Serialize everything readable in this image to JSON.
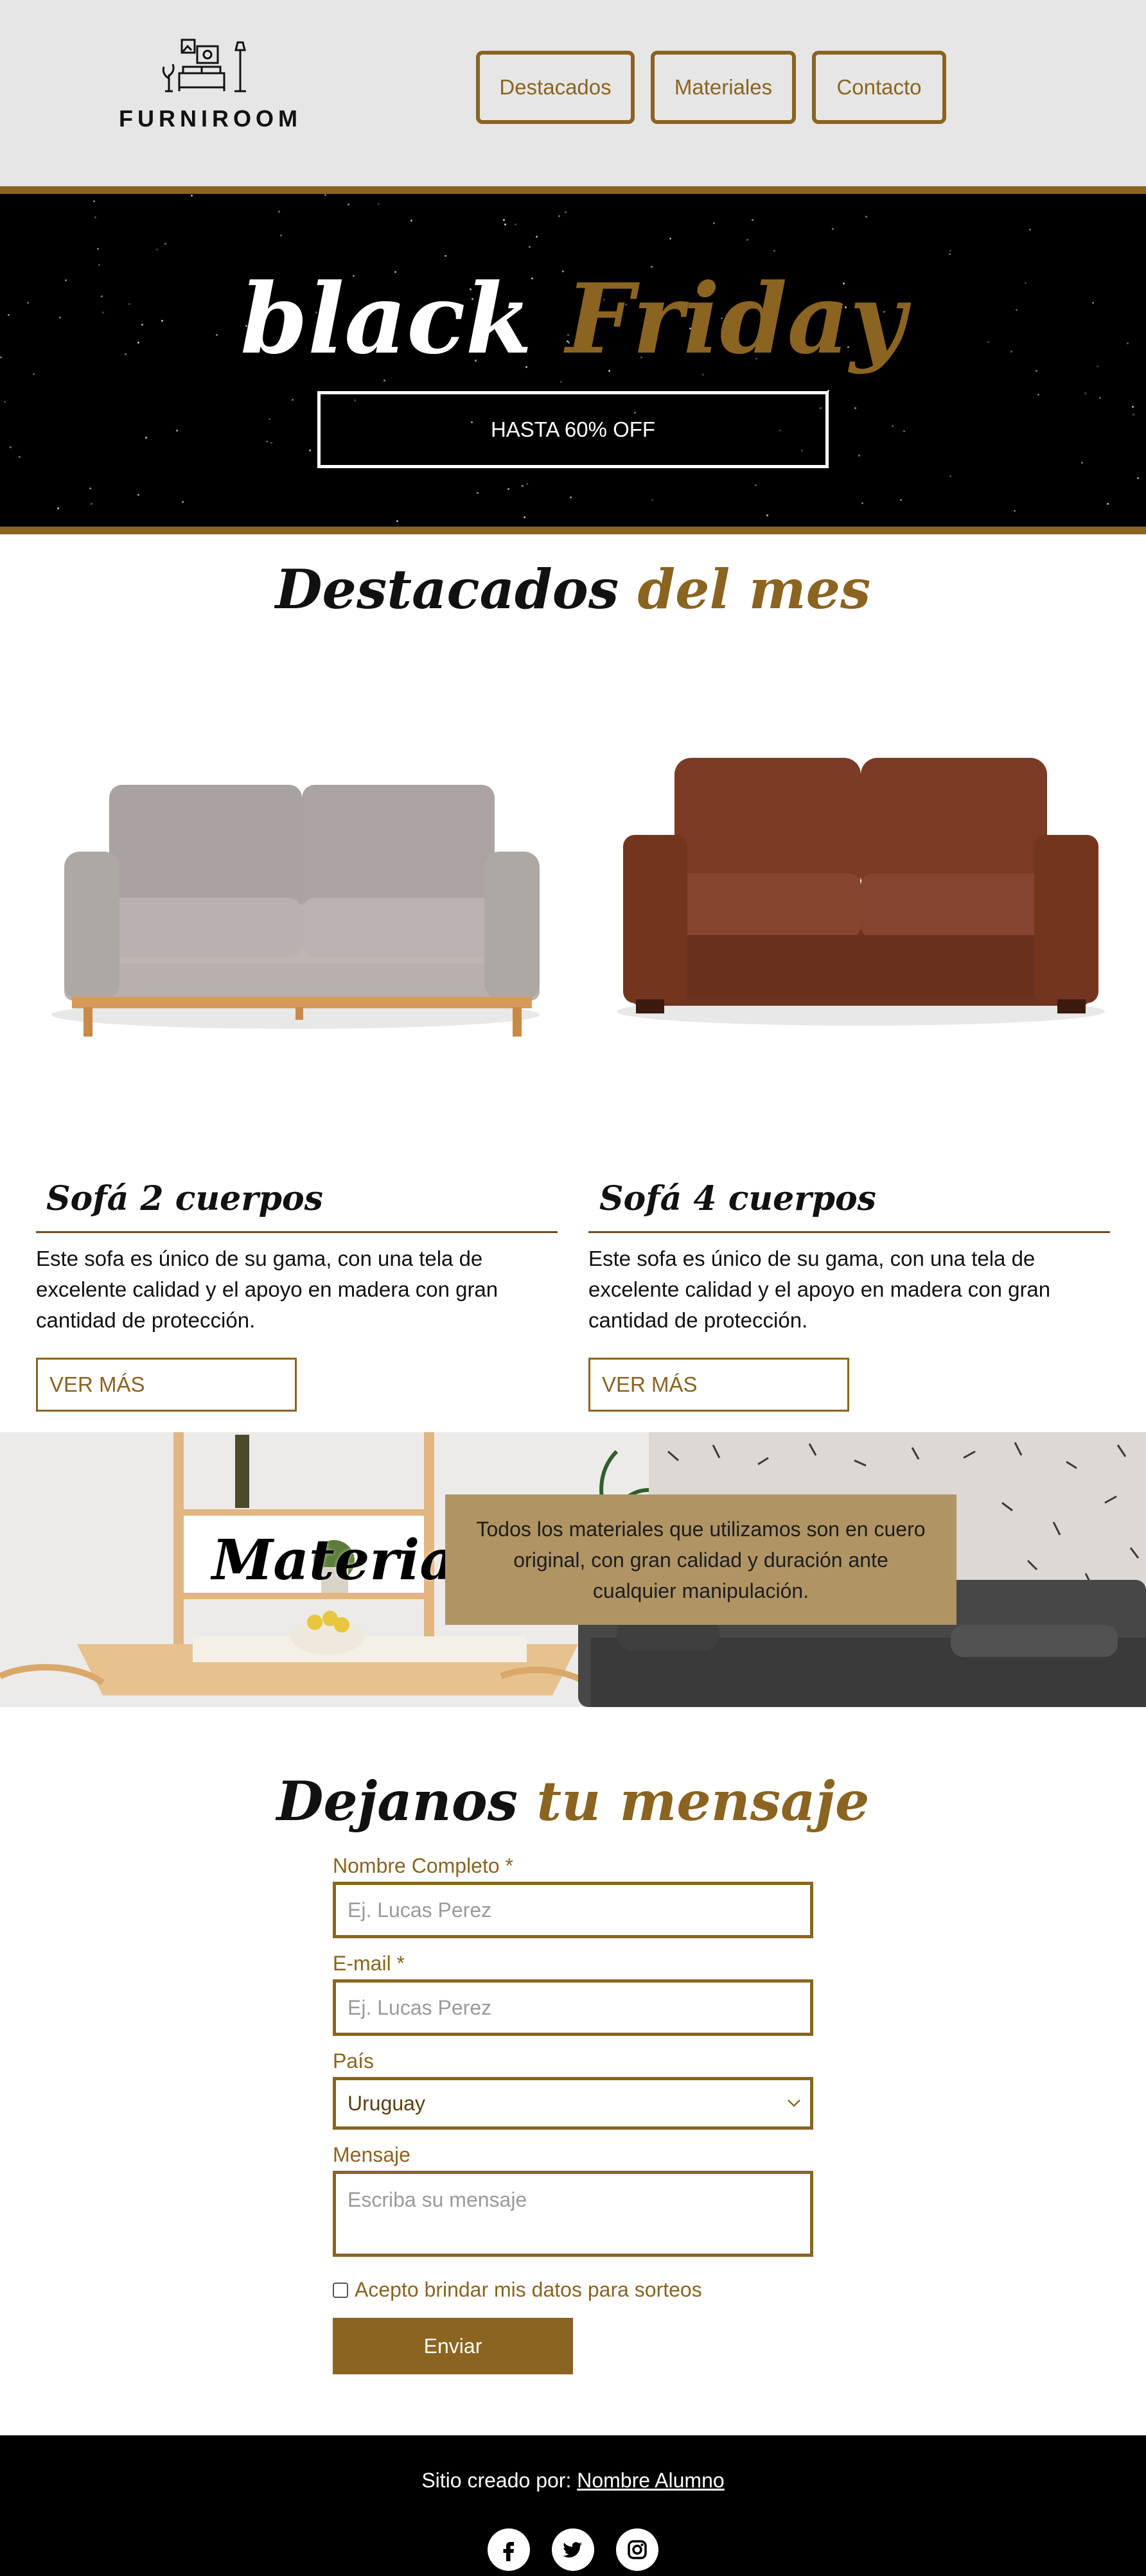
{
  "header": {
    "logo_text": "FURNIROOM",
    "nav": [
      "Destacados",
      "Materiales",
      "Contacto"
    ]
  },
  "hero": {
    "title_white": "black",
    "title_gold": "Friday",
    "cta": "HASTA 60% OFF"
  },
  "destacados": {
    "title_black": "Destacados",
    "title_gold": "del mes",
    "products": [
      {
        "name": "Sofá 2 cuerpos",
        "description": "Este sofa es único de su gama, con una tela de excelente calidad y el apoyo en madera con gran cantidad de protección.",
        "button": "VER MÁS"
      },
      {
        "name": "Sofá 4 cuerpos",
        "description": "Este sofa es único de su gama, con una tela de excelente calidad y el apoyo en madera con gran cantidad de protección.",
        "button": "VER MÁS"
      }
    ]
  },
  "materiales": {
    "title": "Materiales",
    "text": "Todos los materiales que utilizamos son en cuero original, con gran calidad y duración ante cualquier manipulación."
  },
  "contact": {
    "title_black": "Dejanos",
    "title_gold": "tu mensaje",
    "name_label": "Nombre Completo *",
    "name_placeholder": "Ej. Lucas Perez",
    "email_label": "E-mail *",
    "email_placeholder": "Ej. Lucas Perez",
    "country_label": "País",
    "country_value": "Uruguay",
    "message_label": "Mensaje",
    "message_placeholder": "Escriba su mensaje",
    "checkbox_label": "Acepto brindar mis datos para sorteos",
    "submit": "Enviar"
  },
  "footer": {
    "credit_prefix": "Sitio creado por:",
    "credit_link": "Nombre Alumno"
  },
  "colors": {
    "gold": "#8a6420",
    "header_bg": "#e6e6e6",
    "materiales_box": "#b09464"
  },
  "icons": [
    "furniroom-logo-icon",
    "chevron-down-icon",
    "facebook-icon",
    "twitter-icon",
    "instagram-icon"
  ]
}
